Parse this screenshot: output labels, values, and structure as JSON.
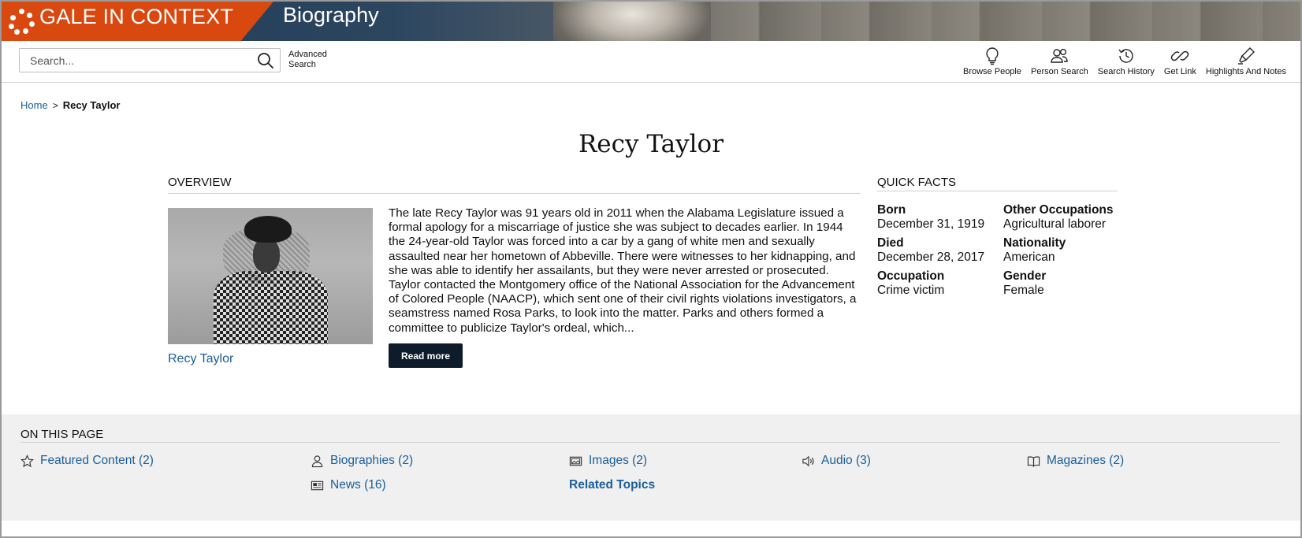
{
  "header": {
    "brand": "GALE IN CONTEXT",
    "product": "Biography"
  },
  "toolbar": {
    "search_placeholder": "Search...",
    "advanced_search": "Advanced Search",
    "tools": [
      {
        "label": "Browse People",
        "icon": "lightbulb-icon"
      },
      {
        "label": "Person Search",
        "icon": "people-icon"
      },
      {
        "label": "Search History",
        "icon": "history-icon"
      },
      {
        "label": "Get Link",
        "icon": "link-icon"
      },
      {
        "label": "Highlights And Notes",
        "icon": "highlighter-icon"
      }
    ]
  },
  "breadcrumb": {
    "home": "Home",
    "separator": ">",
    "current": "Recy Taylor"
  },
  "page": {
    "title": "Recy Taylor"
  },
  "overview": {
    "heading": "OVERVIEW",
    "image_caption": "Recy Taylor",
    "text": "The late Recy Taylor was 91 years old in 2011 when the Alabama Legislature issued a formal apology for a miscarriage of justice she was subject to decades earlier. In 1944 the 24-year-old Taylor was forced into a car by a gang of white men and sexually assaulted near her hometown of Abbeville. There were witnesses to her kidnapping, and she was able to identify her assailants, but they were never arrested or prosecuted. Taylor contacted the Montgomery office of the National Association for the Advancement of Colored People (NAACP), which sent one of their civil rights violations investigators, a seamstress named Rosa Parks, to look into the matter. Parks and others formed a committee to publicize Taylor's ordeal, which...",
    "read_more": "Read more"
  },
  "quick_facts": {
    "heading": "QUICK FACTS",
    "facts": [
      {
        "label": "Born",
        "value": "December 31, 1919"
      },
      {
        "label": "Other Occupations",
        "value": "Agricultural laborer"
      },
      {
        "label": "Died",
        "value": "December 28, 2017"
      },
      {
        "label": "Nationality",
        "value": "American"
      },
      {
        "label": "Occupation",
        "value": "Crime victim"
      },
      {
        "label": "Gender",
        "value": "Female"
      }
    ]
  },
  "on_this_page": {
    "heading": "ON THIS PAGE",
    "links": [
      {
        "label": "Featured Content (2)",
        "icon": "star-icon"
      },
      {
        "label": "Biographies (2)",
        "icon": "person-icon"
      },
      {
        "label": "Images (2)",
        "icon": "images-icon"
      },
      {
        "label": "Audio (3)",
        "icon": "speaker-icon"
      },
      {
        "label": "Magazines (2)",
        "icon": "book-icon"
      },
      {
        "label": "News (16)",
        "icon": "newspaper-icon"
      }
    ],
    "related_topics": "Related Topics"
  },
  "colors": {
    "brand_orange": "#d9480f",
    "link_blue": "#1a5e9a",
    "button_dark": "#0d1b2a",
    "section_gray": "#f0f0f0"
  }
}
